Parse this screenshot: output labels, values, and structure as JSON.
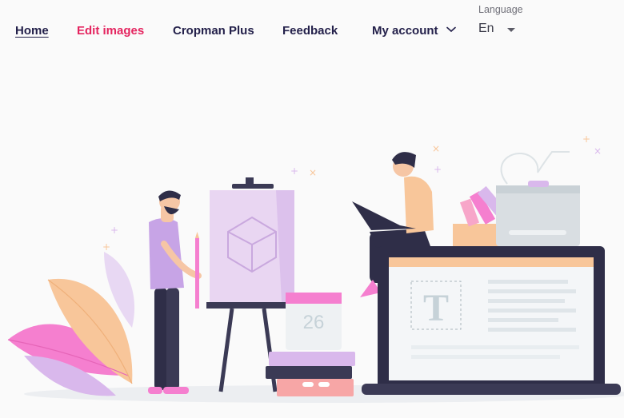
{
  "nav": {
    "home": "Home",
    "edit_images": "Edit images",
    "cropman_plus": "Cropman Plus",
    "feedback": "Feedback",
    "my_account": "My account"
  },
  "language": {
    "label": "Language",
    "value": "En"
  },
  "illustration": {
    "calendar_day": "26",
    "text_tool_glyph": "T"
  },
  "colors": {
    "accent": "#e4245f",
    "nav_text": "#23204a"
  }
}
